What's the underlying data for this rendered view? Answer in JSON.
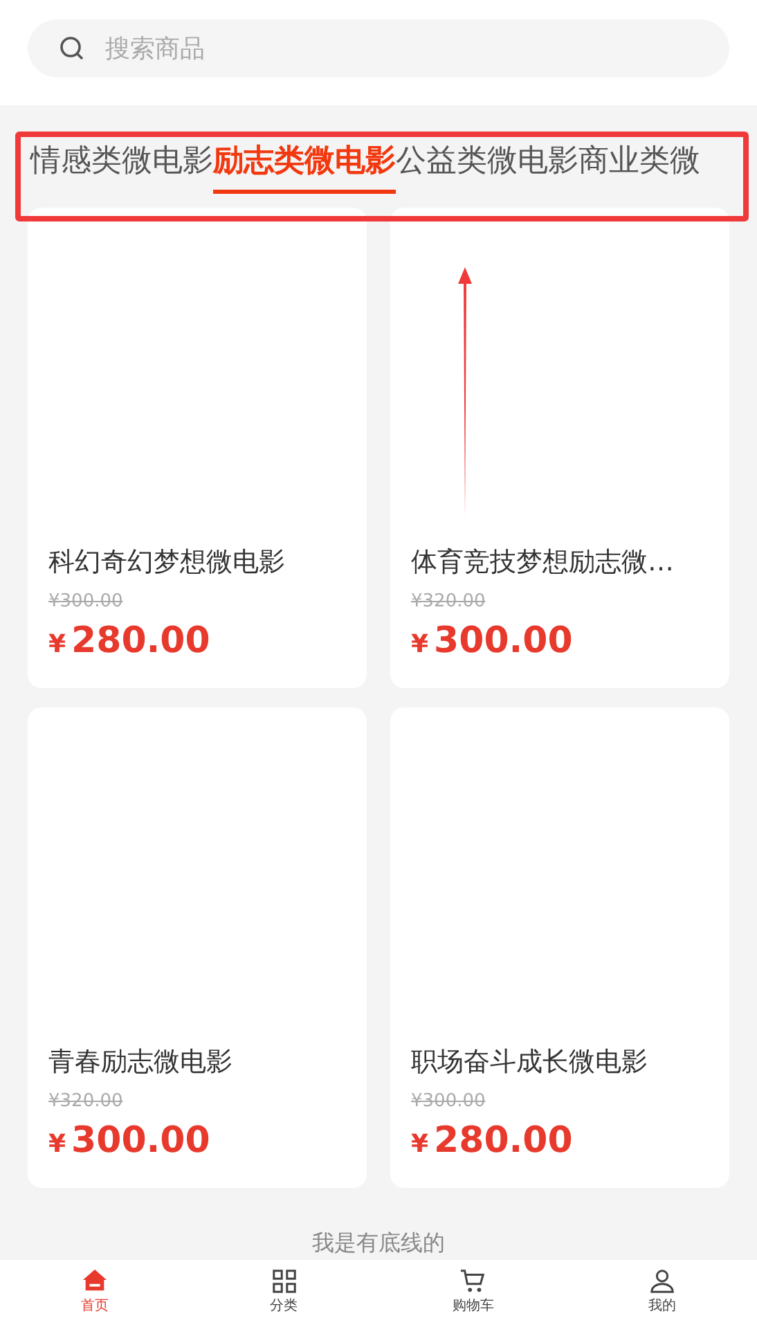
{
  "search": {
    "placeholder": "搜索商品"
  },
  "categories": [
    {
      "label": "情感类微电影",
      "selected": false
    },
    {
      "label": "励志类微电影",
      "selected": true
    },
    {
      "label": "公益类微电影",
      "selected": false
    },
    {
      "label": "商业类微",
      "selected": false
    }
  ],
  "products": [
    {
      "title": "科幻奇幻梦想微电影",
      "original_price": "¥300.00",
      "currency": "¥",
      "price": "280.00"
    },
    {
      "title": "体育竞技梦想励志微…",
      "original_price": "¥320.00",
      "currency": "¥",
      "price": "300.00"
    },
    {
      "title": "青春励志微电影",
      "original_price": "¥320.00",
      "currency": "¥",
      "price": "300.00"
    },
    {
      "title": "职场奋斗成长微电影",
      "original_price": "¥300.00",
      "currency": "¥",
      "price": "280.00"
    }
  ],
  "end_note": "我是有底线的",
  "tab_bar": [
    {
      "kind": "home",
      "label": "首页",
      "selected": true
    },
    {
      "kind": "grid",
      "label": "分类",
      "selected": false
    },
    {
      "kind": "cart",
      "label": "购物车",
      "selected": false
    },
    {
      "kind": "user",
      "label": "我的",
      "selected": false
    }
  ]
}
